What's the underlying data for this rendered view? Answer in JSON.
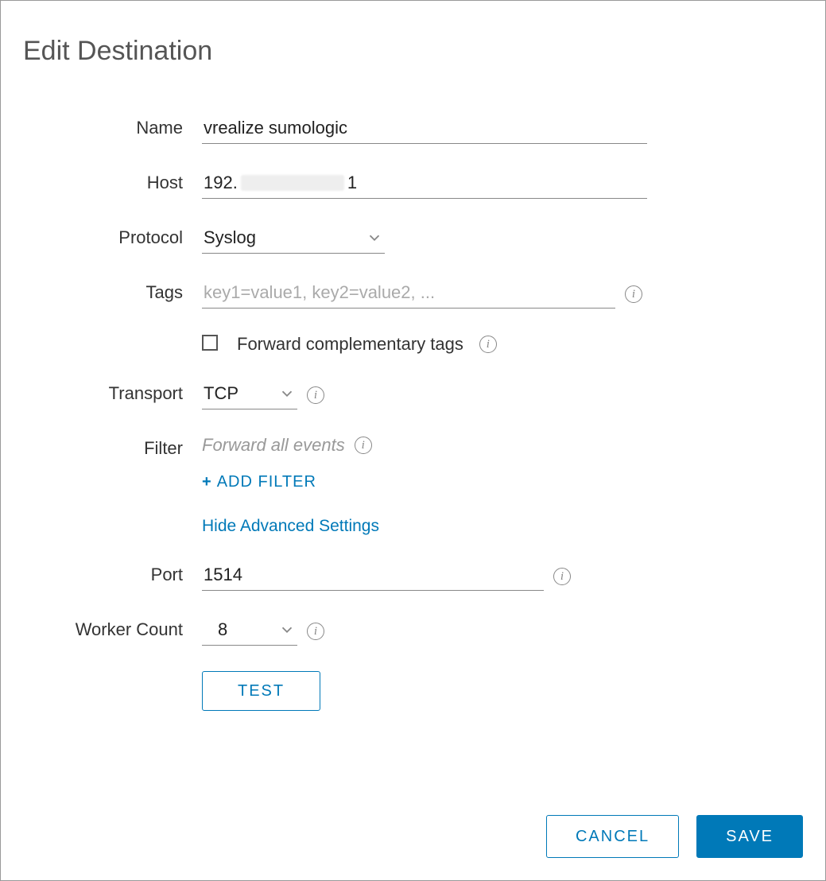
{
  "title": "Edit Destination",
  "fields": {
    "name": {
      "label": "Name",
      "value": "vrealize sumologic"
    },
    "host": {
      "label": "Host",
      "prefix": "192.",
      "suffix": "1"
    },
    "protocol": {
      "label": "Protocol",
      "value": "Syslog"
    },
    "tags": {
      "label": "Tags",
      "placeholder": "key1=value1, key2=value2, ..."
    },
    "fwd_tags": {
      "label": "Forward complementary tags",
      "checked": false
    },
    "transport": {
      "label": "Transport",
      "value": "TCP"
    },
    "filter": {
      "label": "Filter",
      "hint": "Forward all events"
    },
    "add_filter": {
      "label": "ADD FILTER"
    },
    "advanced": {
      "label": "Hide Advanced Settings"
    },
    "port": {
      "label": "Port",
      "value": "1514"
    },
    "workers": {
      "label": "Worker Count",
      "value": "8"
    }
  },
  "buttons": {
    "test": "TEST",
    "cancel": "CANCEL",
    "save": "SAVE"
  }
}
